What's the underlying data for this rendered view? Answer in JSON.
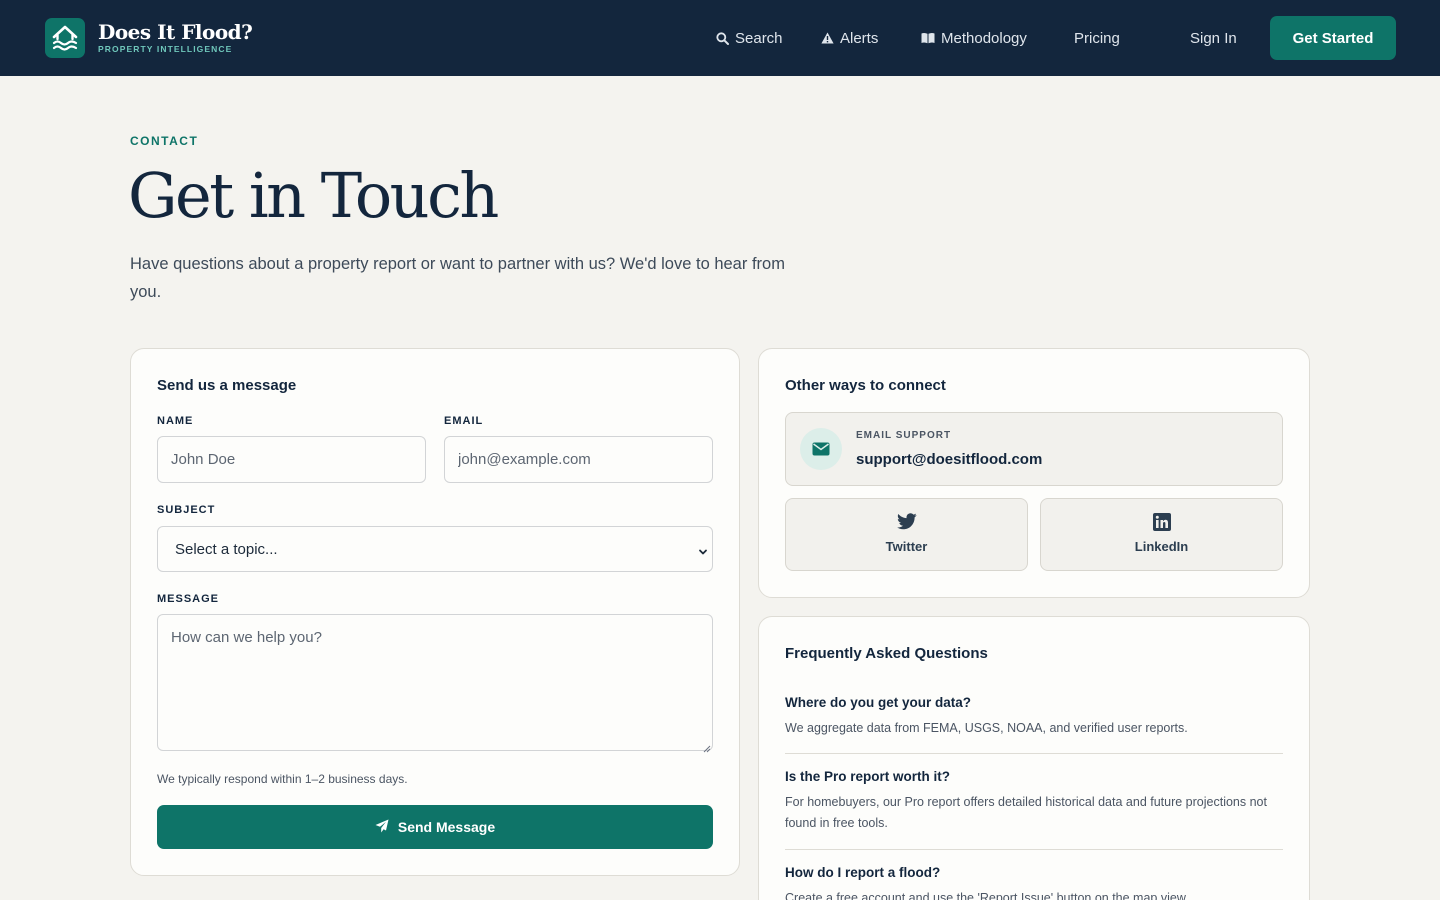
{
  "brand": {
    "name": "Does It Flood?",
    "tagline": "PROPERTY INTELLIGENCE",
    "accent": "#0e7468",
    "navy": "#13263d"
  },
  "nav": {
    "links": [
      {
        "label": "Search",
        "icon": "search-icon"
      },
      {
        "label": "Alerts",
        "icon": "warning-icon"
      },
      {
        "label": "Methodology",
        "icon": "book-icon"
      },
      {
        "label": "Pricing"
      }
    ],
    "sign_in": "Sign In",
    "get_started": "Get Started"
  },
  "hero": {
    "eyebrow": "CONTACT",
    "title": "Get in Touch",
    "intro": "Have questions about a property report or want to partner with us? We'd love to hear from you."
  },
  "form": {
    "title": "Send us a message",
    "name_label": "NAME",
    "name_placeholder": "John Doe",
    "email_label": "EMAIL",
    "email_placeholder": "john@example.com",
    "subject_label": "SUBJECT",
    "subject_value": "Select a topic...",
    "message_label": "MESSAGE",
    "message_placeholder": "How can we help you?",
    "note": "We typically respond within 1–2 business days.",
    "submit": "Send Message"
  },
  "connect": {
    "title": "Other ways to connect",
    "support_label": "EMAIL SUPPORT",
    "support_email": "support@doesitflood.com",
    "socials": [
      {
        "label": "Twitter",
        "icon": "twitter-icon"
      },
      {
        "label": "LinkedIn",
        "icon": "linkedin-icon"
      }
    ]
  },
  "faq": {
    "title": "Frequently Asked Questions",
    "items": [
      {
        "q": "Where do you get your data?",
        "a": "We aggregate data from FEMA, USGS, NOAA, and verified user reports."
      },
      {
        "q": "Is the Pro report worth it?",
        "a": "For homebuyers, our Pro report offers detailed historical data and future projections not found in free tools."
      },
      {
        "q": "How do I report a flood?",
        "a": "Create a free account and use the 'Report Issue' button on the map view."
      }
    ]
  }
}
